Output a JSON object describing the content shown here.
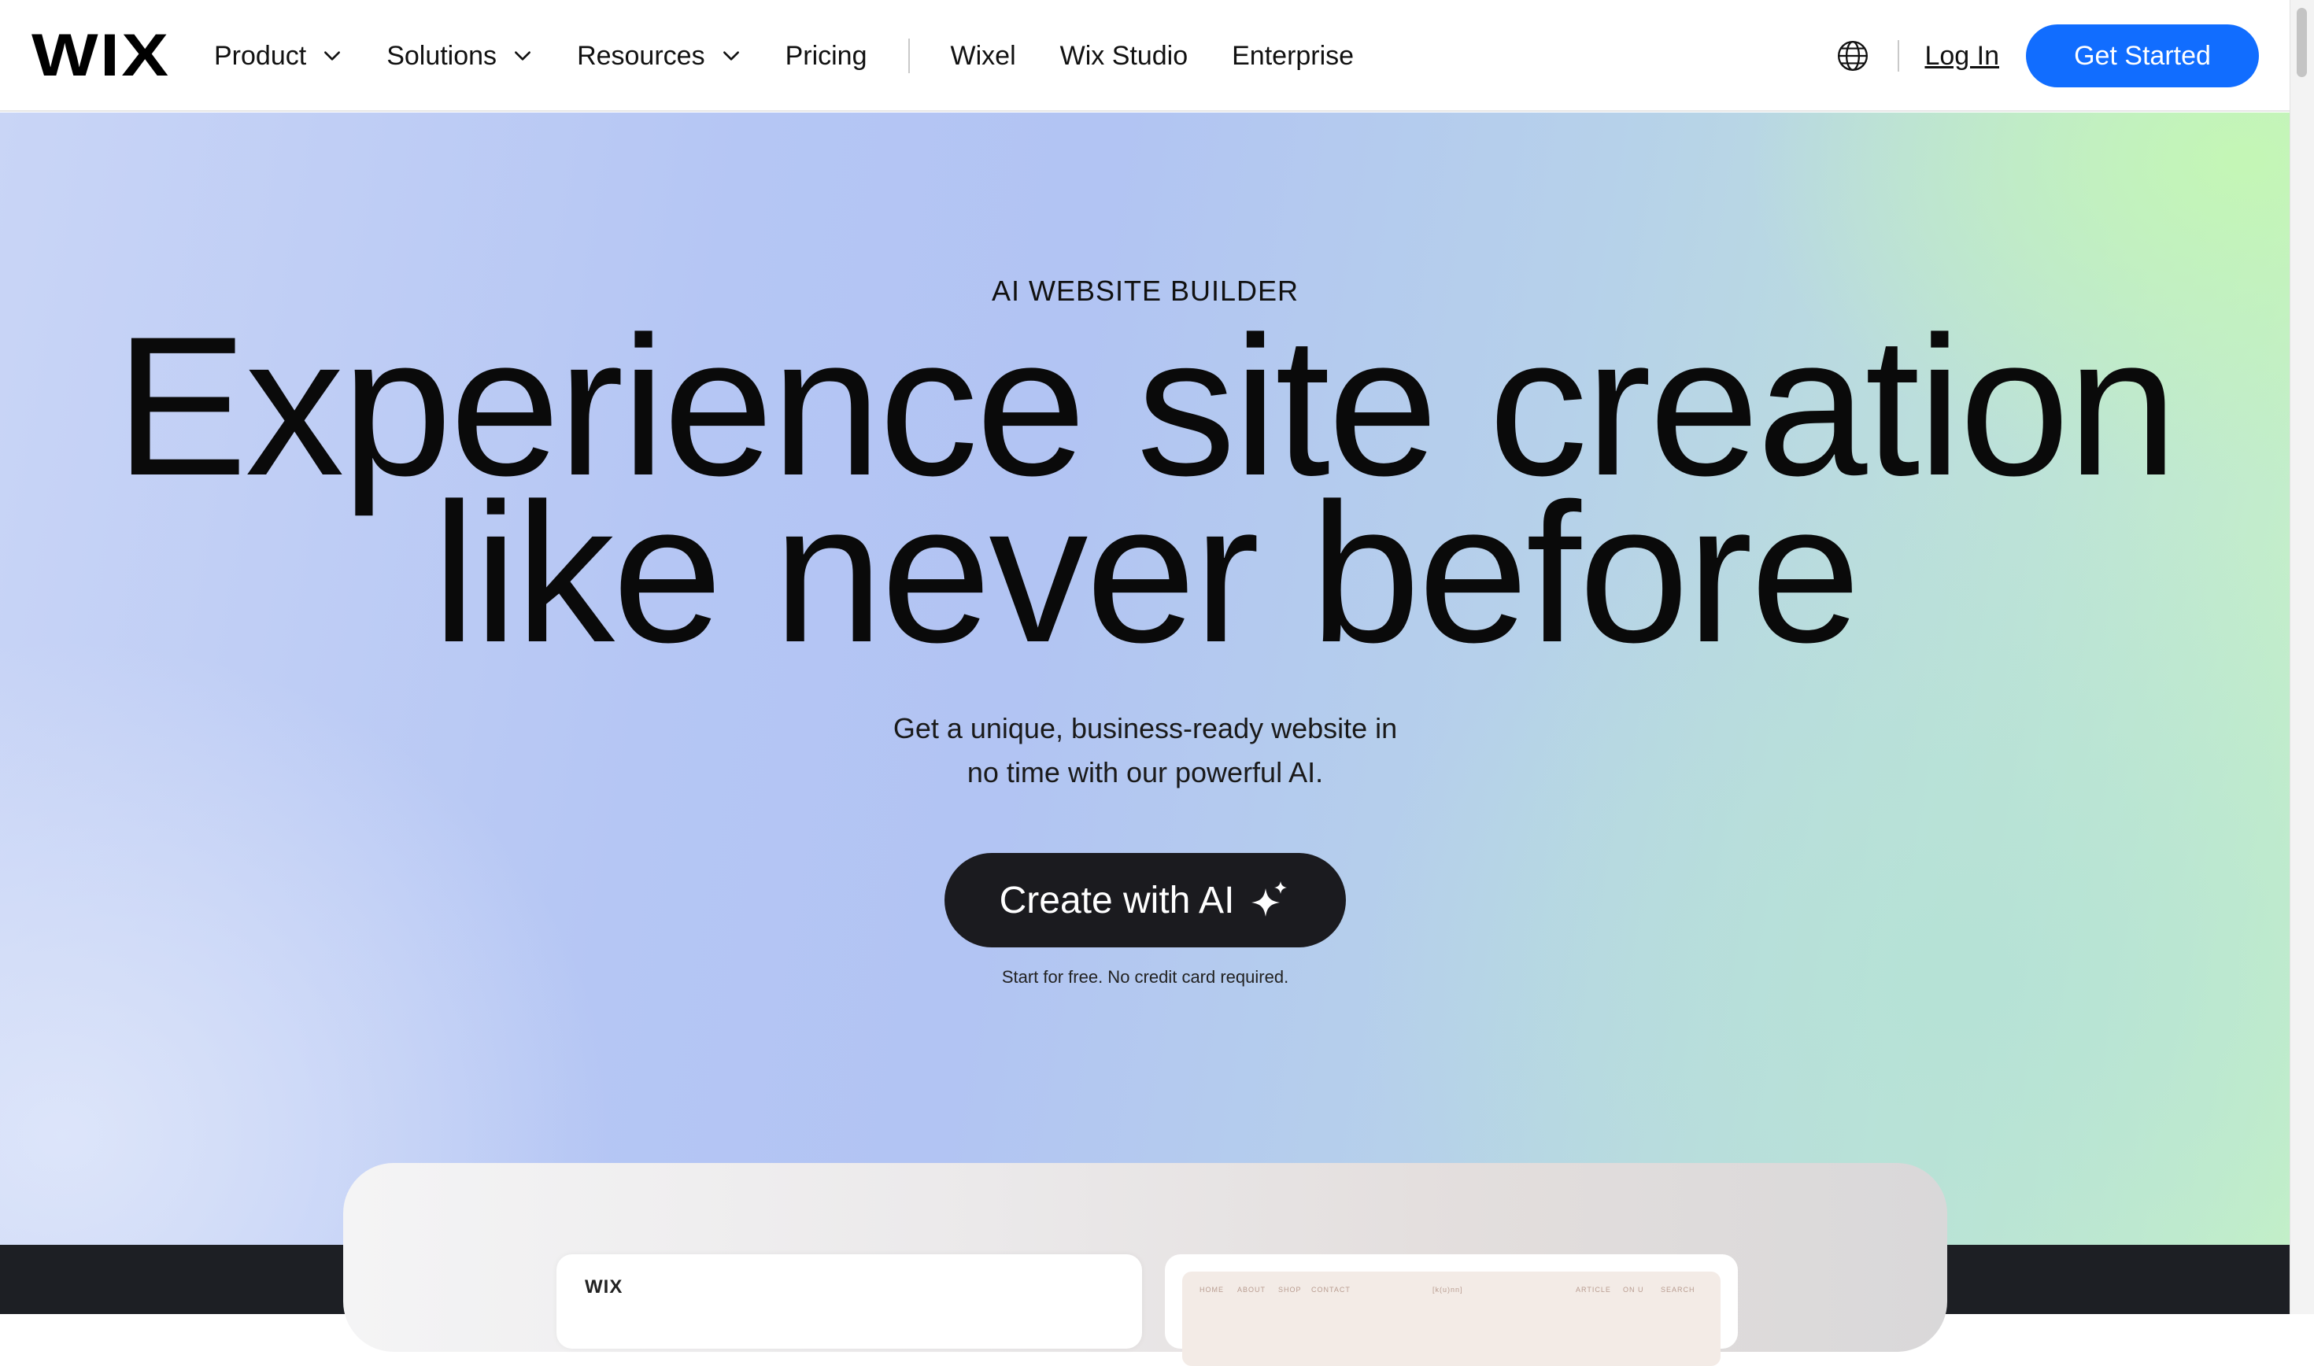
{
  "header": {
    "logo": "WIX",
    "nav": [
      {
        "label": "Product",
        "dropdown": true
      },
      {
        "label": "Solutions",
        "dropdown": true
      },
      {
        "label": "Resources",
        "dropdown": true
      },
      {
        "label": "Pricing",
        "dropdown": false
      }
    ],
    "nav_secondary": [
      {
        "label": "Wixel"
      },
      {
        "label": "Wix Studio"
      },
      {
        "label": "Enterprise"
      }
    ],
    "language_icon": "globe-icon",
    "login_label": "Log In",
    "cta_label": "Get Started"
  },
  "hero": {
    "eyebrow": "AI WEBSITE BUILDER",
    "headline_line1": "Experience site creation",
    "headline_line2": "like never before",
    "subtext_line1": "Get a unique, business-ready website in",
    "subtext_line2": "no time with our powerful AI.",
    "cta_label": "Create with AI",
    "cta_icon": "sparkle-icon",
    "note": "Start for free. No credit card required."
  },
  "preview": {
    "left_card_logo": "WIX",
    "right_card_nav": [
      "HOME",
      "ABOUT",
      "SHOP",
      "CONTACT",
      "[k(u)nn]",
      "ARTICLE",
      "ON U",
      "SEARCH"
    ]
  },
  "colors": {
    "primary": "#116dff",
    "cta_dark": "#1b1b1f",
    "text": "#0a0a0a",
    "band": "#1d1f24"
  }
}
